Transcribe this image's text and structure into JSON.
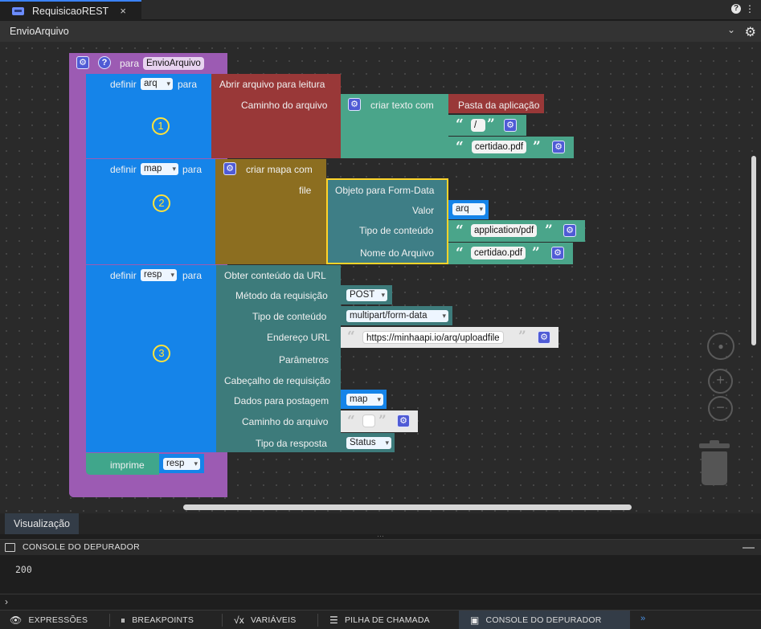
{
  "tab": {
    "label": "RequisicaoREST",
    "close": "×"
  },
  "toolbar": {
    "help": "?",
    "more": "⋮"
  },
  "title": "EnvioArquivo",
  "function_block": {
    "para": "para",
    "name": "EnvioArquivo"
  },
  "step1": {
    "definir": "definir",
    "var": "arq",
    "para": "para",
    "action": "Abrir arquivo para leitura",
    "param": "Caminho do arquivo",
    "criar_texto": "criar texto com",
    "item1": "Pasta da aplicação",
    "item2": "/",
    "item3": "certidao.pdf",
    "num": "1"
  },
  "step2": {
    "definir": "definir",
    "var": "map",
    "para": "para",
    "action": "criar mapa com",
    "key": "file",
    "obj": "Objeto para Form-Data",
    "valor": "Valor",
    "valor_var": "arq",
    "tipo": "Tipo de conteúdo",
    "tipo_val": "application/pdf",
    "nome": "Nome do Arquivo",
    "nome_val": "certidao.pdf",
    "num": "2"
  },
  "step3": {
    "definir": "definir",
    "var": "resp",
    "para": "para",
    "action": "Obter conteúdo da URL",
    "metodo": "Método da requisição",
    "metodo_val": "POST",
    "tipo": "Tipo de conteúdo",
    "tipo_val": "multipart/form-data",
    "endereco": "Endereço URL",
    "endereco_val": "https://minhaapi.io/arq/uploadfile",
    "parametros": "Parâmetros",
    "cabecalho": "Cabeçalho de requisição",
    "dados": "Dados para postagem",
    "dados_val": "map",
    "caminho": "Caminho do arquivo",
    "tipo_resp": "Tipo da resposta",
    "tipo_resp_val": "Status",
    "num": "3"
  },
  "imprime": {
    "label": "imprime",
    "var": "resp"
  },
  "visualizacao": "Visualização",
  "console": {
    "title": "CONSOLE DO DEPURADOR",
    "output": "200",
    "prompt": "›"
  },
  "bottom_tabs": [
    {
      "label": "EXPRESSÕES",
      "icon": "eye-icon"
    },
    {
      "label": "BREAKPOINTS",
      "icon": "pause-icon"
    },
    {
      "label": "VARIÁVEIS",
      "icon": "sqrt-icon"
    },
    {
      "label": "PILHA DE CHAMADA",
      "icon": "stack-icon"
    },
    {
      "label": "CONSOLE DO DEPURADOR",
      "icon": "terminal-icon"
    }
  ],
  "colors": {
    "function": "#9b59b6",
    "set": "#0f7be6",
    "file_action": "#9b3b3b",
    "text": "#4aa287",
    "map": "#8b6d1f",
    "formdata": "#3d7e86",
    "url": "#3d7a7a",
    "print": "#3fa58a",
    "highlight": "#ffd42a"
  }
}
